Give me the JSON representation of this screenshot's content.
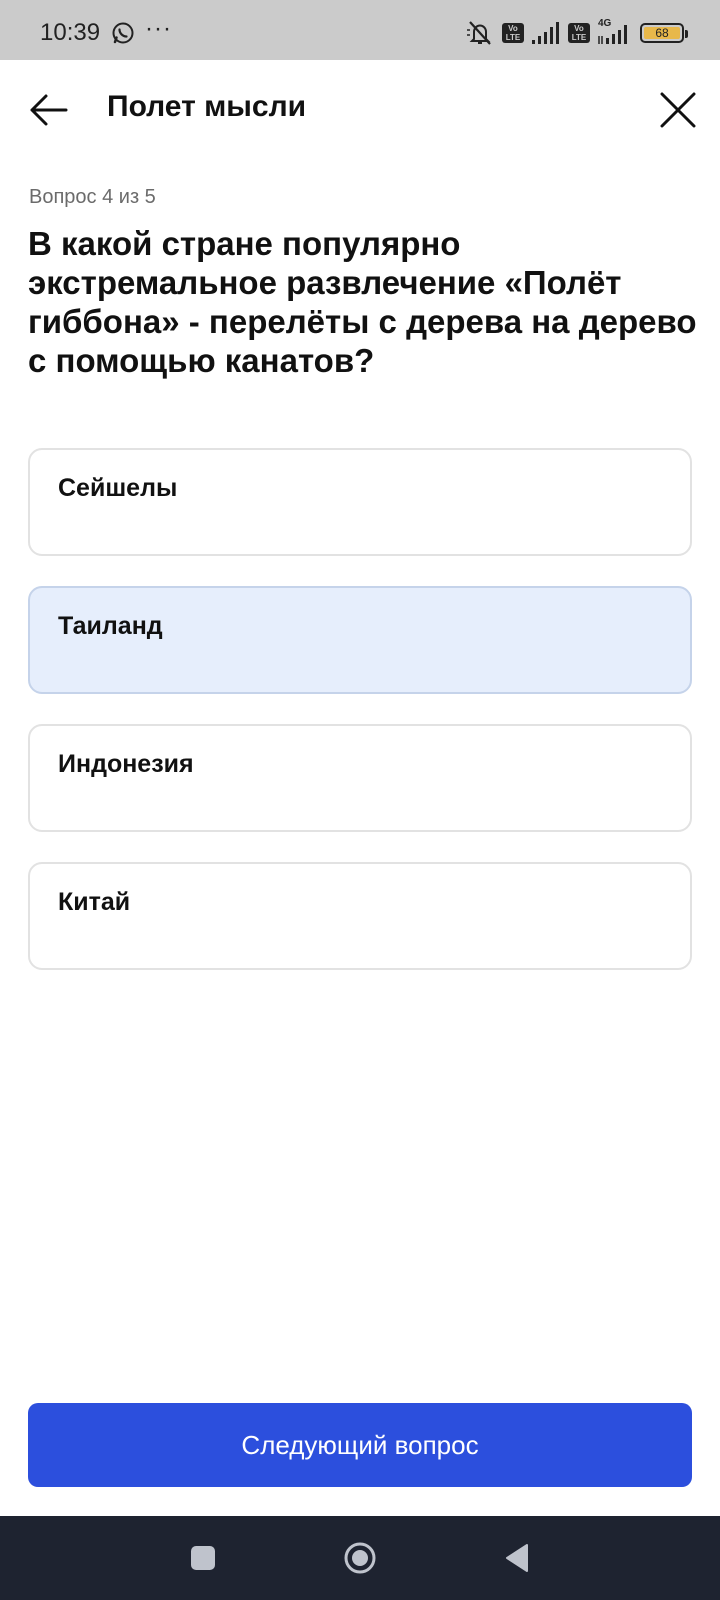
{
  "status_bar": {
    "time": "10:39",
    "more": "···",
    "volte1": "Vo LTE",
    "volte2": "Vo LTE",
    "network": "4G",
    "battery": "68",
    "battery_color": "#e8b84a"
  },
  "header": {
    "title": "Полет мысли",
    "back_icon": "arrow-left-icon",
    "close_icon": "close-icon"
  },
  "quiz": {
    "progress": "Вопрос 4 из 5",
    "question": "В какой стране популярно экстремальное развлечение «Полёт гиббона» - перелёты с дерева на дерево с помощью канатов?",
    "options": [
      {
        "label": "Сейшелы",
        "selected": false
      },
      {
        "label": "Таиланд",
        "selected": true
      },
      {
        "label": "Индонезия",
        "selected": false
      },
      {
        "label": "Китай",
        "selected": false
      }
    ],
    "next_label": "Следующий вопрос"
  },
  "colors": {
    "accent": "#2c4fdd",
    "selected_bg": "#e6eefc",
    "nav_bg": "#1e2330"
  }
}
